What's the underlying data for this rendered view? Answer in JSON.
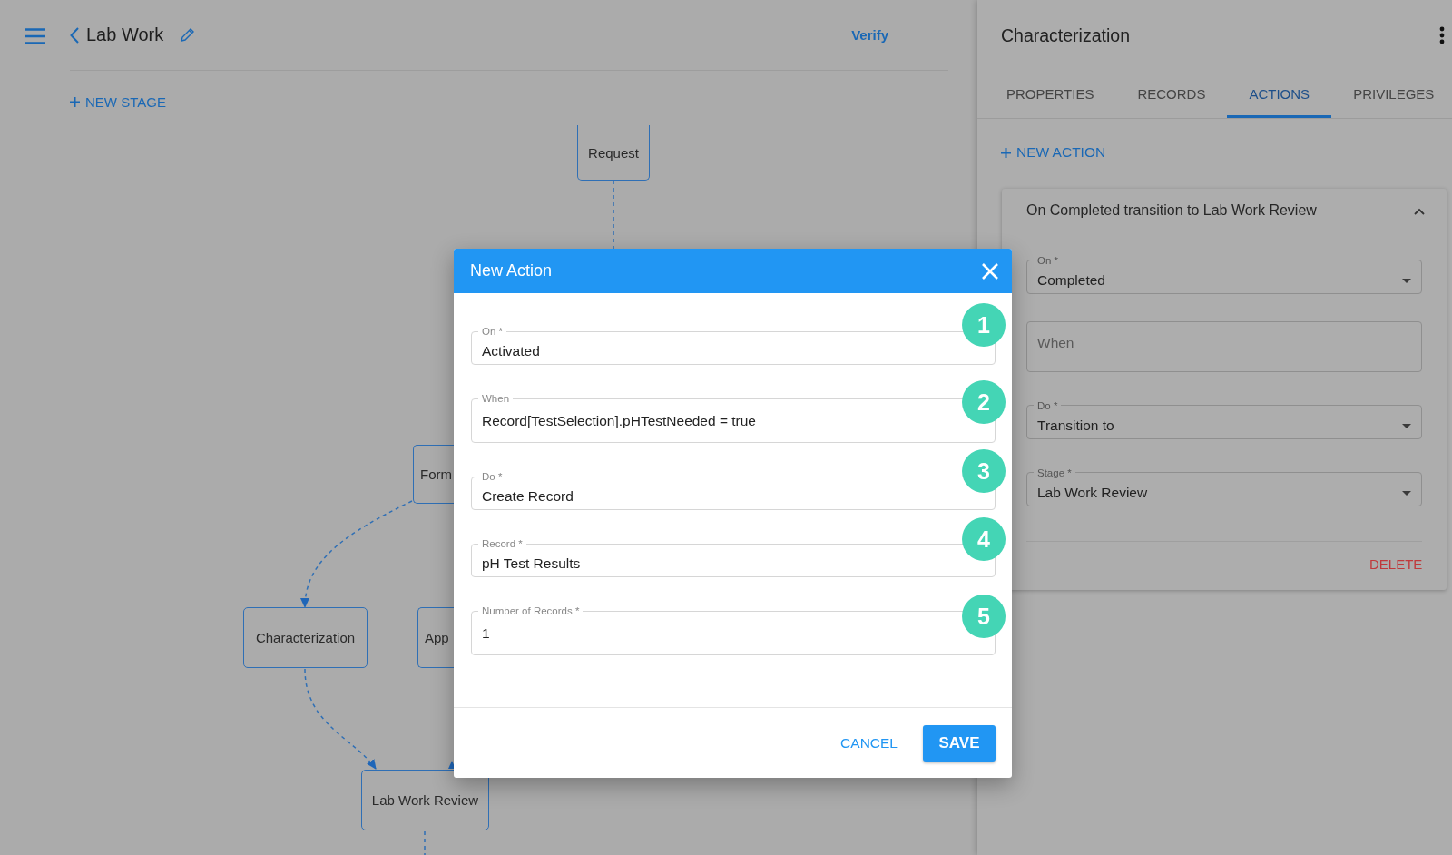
{
  "app_bar": {
    "title": "Lab Work",
    "verify": "Verify"
  },
  "new_stage": "NEW STAGE",
  "diagram": {
    "nodes": [
      "Request",
      "Form",
      "Characterization",
      "App",
      "Lab Work Review"
    ]
  },
  "panel": {
    "title": "Characterization",
    "tabs": [
      {
        "label": "PROPERTIES",
        "selected": false
      },
      {
        "label": "RECORDS",
        "selected": false
      },
      {
        "label": "ACTIONS",
        "selected": true
      },
      {
        "label": "PRIVILEGES",
        "selected": false
      }
    ],
    "new_action": "NEW ACTION",
    "action": {
      "summary": "On Completed transition to Lab Work Review",
      "expanded": true,
      "fields": [
        {
          "kind": "select",
          "label": "On *",
          "value": "Completed"
        },
        {
          "kind": "text",
          "placeholder": "When"
        },
        {
          "kind": "select",
          "label": "Do *",
          "value": "Transition to"
        },
        {
          "kind": "select",
          "label": "Stage *",
          "value": "Lab Work Review"
        }
      ],
      "delete": "DELETE"
    }
  },
  "dialog": {
    "title": "New Action",
    "fields": [
      {
        "kind": "select",
        "label": "On *",
        "value": "Activated"
      },
      {
        "kind": "text",
        "label": "When",
        "value": "Record[TestSelection].pHTestNeeded = true"
      },
      {
        "kind": "select",
        "label": "Do *",
        "value": "Create Record"
      },
      {
        "kind": "select",
        "label": "Record *",
        "value": "pH Test Results"
      },
      {
        "kind": "text",
        "label": "Number of Records *",
        "value": "1"
      }
    ],
    "cancel": "CANCEL",
    "save": "SAVE"
  },
  "annotations": [
    "1",
    "2",
    "3",
    "4",
    "5"
  ]
}
